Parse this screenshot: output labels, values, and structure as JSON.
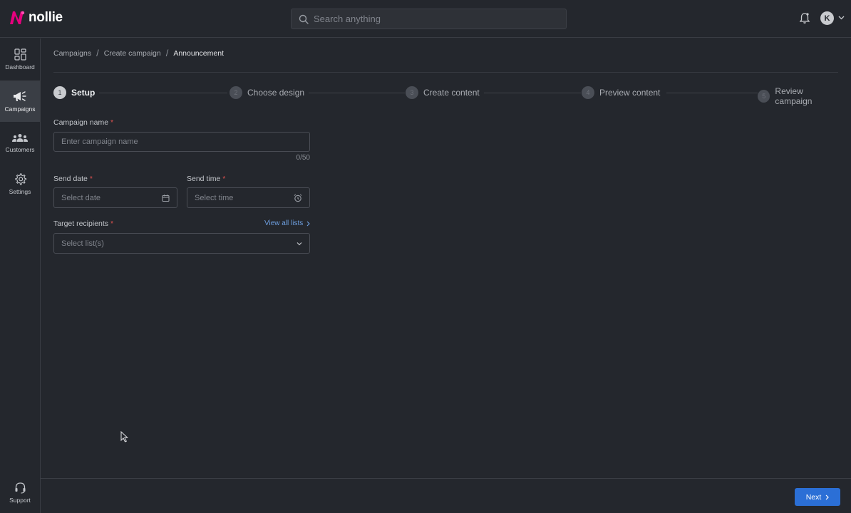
{
  "app": {
    "brand": "nollie",
    "brand_color": "#e6007e"
  },
  "search": {
    "placeholder": "Search anything"
  },
  "user": {
    "avatar_initial": "K"
  },
  "sidebar": {
    "items": [
      {
        "label": "Dashboard",
        "icon": "dashboard-icon",
        "active": false
      },
      {
        "label": "Campaigns",
        "icon": "megaphone-icon",
        "active": true
      },
      {
        "label": "Customers",
        "icon": "customers-icon",
        "active": false
      },
      {
        "label": "Settings",
        "icon": "gear-icon",
        "active": false
      }
    ],
    "support": {
      "label": "Support",
      "icon": "headset-icon"
    }
  },
  "breadcrumb": {
    "items": [
      "Campaigns",
      "Create campaign"
    ],
    "current": "Announcement",
    "separator": "/"
  },
  "steps": [
    {
      "number": "1",
      "label": "Setup",
      "active": true
    },
    {
      "number": "2",
      "label": "Choose design",
      "active": false
    },
    {
      "number": "3",
      "label": "Create content",
      "active": false
    },
    {
      "number": "4",
      "label": "Preview content",
      "active": false
    },
    {
      "number": "5",
      "label": "Review campaign",
      "active": false
    }
  ],
  "form": {
    "required_mark": "*",
    "campaign_name": {
      "label": "Campaign name",
      "placeholder": "Enter campaign name",
      "value": "",
      "counter": "0/50"
    },
    "send_date": {
      "label": "Send date",
      "placeholder": "Select date",
      "icon": "calendar-icon"
    },
    "send_time": {
      "label": "Send time",
      "placeholder": "Select time",
      "icon": "alarm-clock-icon"
    },
    "target_recipients": {
      "label": "Target recipients",
      "placeholder": "Select list(s)",
      "view_all_link": "View all lists"
    }
  },
  "footer": {
    "next_label": "Next",
    "accent_color": "#2b6fd6"
  }
}
